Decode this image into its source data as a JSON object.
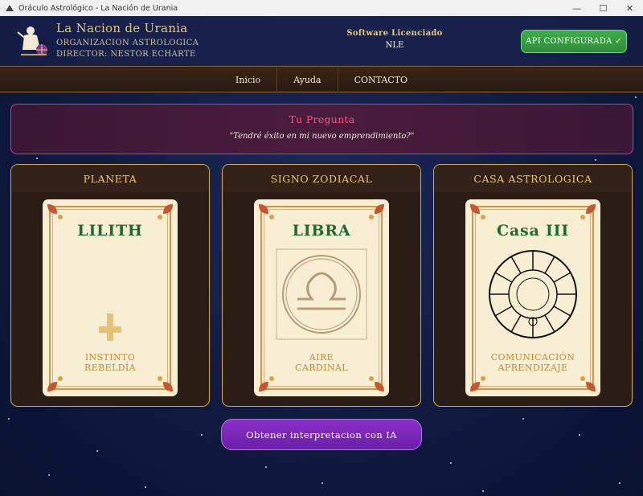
{
  "window": {
    "title": "Oráculo Astrológico - La Nación de Urania",
    "minimize": "—",
    "maximize": "☐",
    "close": "✕"
  },
  "header": {
    "brand_name": "La Nacion de Urania",
    "organization": "ORGANIZACION ASTROLOGICA",
    "director": "DIRECTOR: NESTOR ECHARTE",
    "license_label": "Software Licenciado",
    "license_value": "NLE",
    "api_button": "API CONFIGURADA ✓"
  },
  "nav": {
    "items": [
      "Inicio",
      "Ayuda",
      "CONTACTO"
    ]
  },
  "question": {
    "title": "Tu Pregunta",
    "text": "\"Tendré éxito en mi nuevo emprendimiento?\""
  },
  "panels": [
    {
      "heading": "PLANETA",
      "card_title": "LILITH",
      "keywords": [
        "INSTINTO",
        "REBELDÍA"
      ],
      "icon": "lilith-glyph"
    },
    {
      "heading": "SIGNO ZODIACAL",
      "card_title": "LIBRA",
      "keywords": [
        "AIRE",
        "CARDINAL"
      ],
      "icon": "libra-glyph"
    },
    {
      "heading": "CASA ASTROLOGICA",
      "card_title": "Casa III",
      "keywords": [
        "COMUNICACIÓN",
        "APRENDIZAJE"
      ],
      "icon": "house-wheel"
    }
  ],
  "cta_button": "Obtener interpretacion con IA",
  "colors": {
    "accent_gold": "#e9c878",
    "api_green": "#2e8b38",
    "question_pink": "#ff4f82",
    "cta_purple": "#6a1fa8",
    "card_green": "#1f6b2f"
  }
}
